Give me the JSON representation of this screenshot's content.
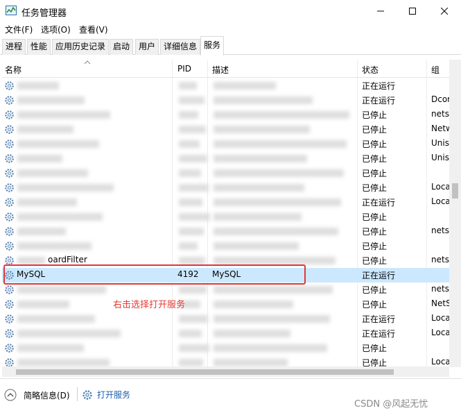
{
  "window": {
    "title": "任务管理器",
    "icon": "task-manager-icon",
    "controls": [
      "minimize",
      "maximize",
      "close"
    ]
  },
  "menu": [
    "文件(F)",
    "选项(O)",
    "查看(V)"
  ],
  "tabs": [
    {
      "label": "进程"
    },
    {
      "label": "性能"
    },
    {
      "label": "应用历史记录"
    },
    {
      "label": "启动"
    },
    {
      "label": "用户"
    },
    {
      "label": "详细信息"
    },
    {
      "label": "服务",
      "active": true
    }
  ],
  "table": {
    "columns": [
      "名称",
      "PID",
      "描述",
      "状态",
      "组"
    ],
    "rows": [
      {
        "name": "",
        "pid": "",
        "desc": "",
        "status": "正在运行",
        "group": ""
      },
      {
        "name": "",
        "pid": "",
        "desc": "",
        "status": "正在运行",
        "group": "Dcor"
      },
      {
        "name": "",
        "pid": "",
        "desc": "",
        "status": "已停止",
        "group": "nets"
      },
      {
        "name": "",
        "pid": "",
        "desc": "",
        "status": "已停止",
        "group": "Netw"
      },
      {
        "name": "",
        "pid": "",
        "desc": "",
        "status": "已停止",
        "group": "Unis"
      },
      {
        "name": "",
        "pid": "",
        "desc": "",
        "status": "已停止",
        "group": "Unis"
      },
      {
        "name": "",
        "pid": "",
        "desc": "",
        "status": "已停止",
        "group": ""
      },
      {
        "name": "",
        "pid": "",
        "desc": "",
        "status": "已停止",
        "group": "Loca"
      },
      {
        "name": "",
        "pid": "",
        "desc": "",
        "status": "正在运行",
        "group": "Loca"
      },
      {
        "name": "",
        "pid": "",
        "desc": "",
        "status": "已停止",
        "group": ""
      },
      {
        "name": "",
        "pid": "",
        "desc": "",
        "status": "已停止",
        "group": "nets"
      },
      {
        "name": "",
        "pid": "",
        "desc": "",
        "status": "已停止",
        "group": ""
      },
      {
        "name": "oardFilter",
        "pid": "",
        "desc": "",
        "status": "已停止",
        "group": "nets"
      },
      {
        "name": "MySQL",
        "pid": "4192",
        "desc": "MySQL",
        "status": "正在运行",
        "group": "",
        "selected": true
      },
      {
        "name": "",
        "pid": "",
        "desc": "",
        "status": "已停止",
        "group": "nets"
      },
      {
        "name": "",
        "pid": "",
        "desc": "",
        "status": "已停止",
        "group": "NetS"
      },
      {
        "name": "",
        "pid": "",
        "desc": "",
        "status": "正在运行",
        "group": "Loca"
      },
      {
        "name": "",
        "pid": "",
        "desc": "",
        "status": "正在运行",
        "group": "Loca"
      },
      {
        "name": "",
        "pid": "",
        "desc": "",
        "status": "已停止",
        "group": ""
      },
      {
        "name": "",
        "pid": "",
        "desc": "",
        "status": "已停止",
        "group": "Loca"
      }
    ]
  },
  "annotation": {
    "text": "右击选择打开服务",
    "color": "#e53935"
  },
  "statusbar": {
    "brief_info": "简略信息(D)",
    "open_services": "打开服务"
  },
  "watermark": "CSDN @风起无忧",
  "colors": {
    "selected_row": "#cce8ff",
    "annotation_border": "#e23636",
    "link": "#1c5fb0"
  }
}
